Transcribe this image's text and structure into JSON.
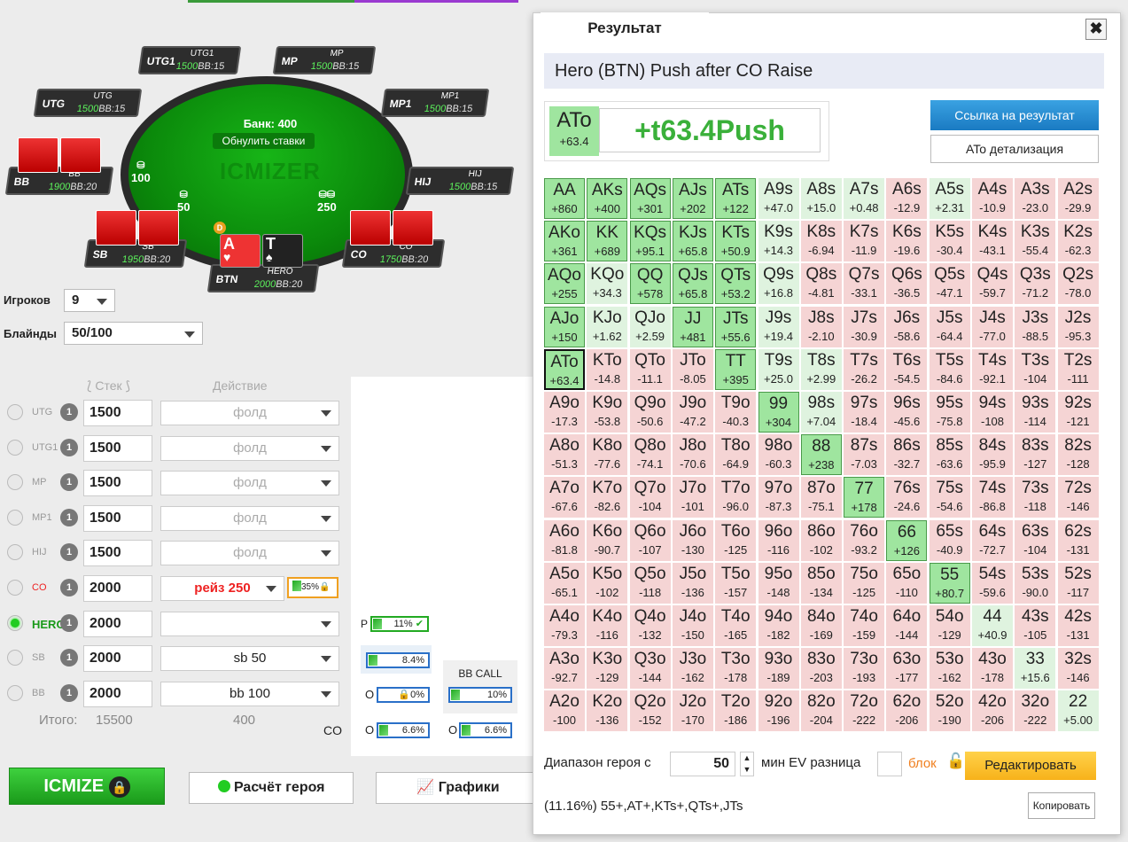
{
  "table": {
    "bank": "Банк: 400",
    "reset": "Обнулить ставки",
    "watermark": "ICMIZER",
    "seats": [
      {
        "id": "utg1",
        "n": "UTG1",
        "pn": "UTG1",
        "st": "1500",
        "bb": "BB:15"
      },
      {
        "id": "mp",
        "n": "MP",
        "pn": "MP",
        "st": "1500",
        "bb": "BB:15"
      },
      {
        "id": "utg",
        "n": "UTG",
        "pn": "UTG",
        "st": "1500",
        "bb": "BB:15"
      },
      {
        "id": "mp1",
        "n": "MP1",
        "pn": "MP1",
        "st": "1500",
        "bb": "BB:15"
      },
      {
        "id": "bb",
        "n": "BB",
        "pn": "BB",
        "st": "1900",
        "bb": "BB:20"
      },
      {
        "id": "hij",
        "n": "HIJ",
        "pn": "HIJ",
        "st": "1500",
        "bb": "BB:15"
      },
      {
        "id": "sb",
        "n": "SB",
        "pn": "SB",
        "st": "1950",
        "bb": "BB:20"
      },
      {
        "id": "co",
        "n": "CO",
        "pn": "CO",
        "st": "1750",
        "bb": "BB:20"
      },
      {
        "id": "btn",
        "n": "BTN",
        "pn": "HERO",
        "st": "2000",
        "bb": "BB:20"
      }
    ],
    "chips": {
      "bb": "100",
      "sb": "50",
      "co": "250"
    },
    "dealer": "D",
    "hero_cards": [
      "A",
      "T"
    ]
  },
  "players_label": "Игроков",
  "players_value": "9",
  "blinds_label": "Блайнды",
  "blinds_value": "50/100",
  "col_stack": "Стек",
  "col_action": "Действие",
  "positions": [
    {
      "pos": "UTG",
      "stack": "1500",
      "action": "фолд"
    },
    {
      "pos": "UTG1",
      "stack": "1500",
      "action": "фолд"
    },
    {
      "pos": "MP",
      "stack": "1500",
      "action": "фолд"
    },
    {
      "pos": "MP1",
      "stack": "1500",
      "action": "фолд"
    },
    {
      "pos": "HIJ",
      "stack": "1500",
      "action": "фолд"
    },
    {
      "pos": "CO",
      "stack": "2000",
      "action": "рейз 250"
    },
    {
      "pos": "HERO",
      "stack": "2000",
      "action": ""
    },
    {
      "pos": "SB",
      "stack": "2000",
      "action": "sb 50"
    },
    {
      "pos": "BB",
      "stack": "2000",
      "action": "bb 100"
    }
  ],
  "badge_one": "1",
  "co_range_pct": "35%",
  "total_label": "Итого:",
  "total_stack": "15500",
  "total_action": "400",
  "range_boxes": {
    "p_label": "P",
    "p_val": "11%",
    "v1": "8.4%",
    "bbcall_label": "BB CALL",
    "bbcall_val": "10%",
    "o1_label": "O",
    "o1_val": "0%",
    "o2_label": "O",
    "o2_val": "6.6%",
    "o3_label": "O",
    "o3_val": "6.6%",
    "co_label": "CO"
  },
  "buttons": {
    "icmize": "ICMIZE",
    "hero_calc": "Расчёт героя",
    "charts": "Графики"
  },
  "result": {
    "tab": "Результат",
    "close": "✖",
    "title": "Hero (BTN) Push after CO Raise",
    "hand": "ATo",
    "hand_ev": "+63.4",
    "verdict": "+t63.4Push",
    "link_btn": "Ссылка на результат",
    "detail_btn": "ATo детализация",
    "range_label": "Диапазон героя с",
    "range_value": "50",
    "ev_label": "мин EV разница",
    "block_label": "блок",
    "edit_btn": "Редактировать",
    "summary": "(11.16%) 55+,AT+,KTs+,QTs+,JTs",
    "copy_btn": "Копировать"
  },
  "colors": {
    "push": "#9fe59f",
    "fold": "#f5d4d4",
    "marginal": "#dff3df",
    "accent": "#3ab03a"
  },
  "grid": [
    [
      [
        "AA",
        "+860",
        "g"
      ],
      [
        "AKs",
        "+400",
        "g"
      ],
      [
        "AQs",
        "+301",
        "g"
      ],
      [
        "AJs",
        "+202",
        "g"
      ],
      [
        "ATs",
        "+122",
        "g"
      ],
      [
        "A9s",
        "+47.0",
        "lg"
      ],
      [
        "A8s",
        "+15.0",
        "lg"
      ],
      [
        "A7s",
        "+0.48",
        "lg"
      ],
      [
        "A6s",
        "-12.9",
        "r"
      ],
      [
        "A5s",
        "+2.31",
        "lg"
      ],
      [
        "A4s",
        "-10.9",
        "r"
      ],
      [
        "A3s",
        "-23.0",
        "r"
      ],
      [
        "A2s",
        "-29.9",
        "r"
      ]
    ],
    [
      [
        "AKo",
        "+361",
        "g"
      ],
      [
        "KK",
        "+689",
        "g"
      ],
      [
        "KQs",
        "+95.1",
        "g"
      ],
      [
        "KJs",
        "+65.8",
        "g"
      ],
      [
        "KTs",
        "+50.9",
        "g"
      ],
      [
        "K9s",
        "+14.3",
        "lg"
      ],
      [
        "K8s",
        "-6.94",
        "r"
      ],
      [
        "K7s",
        "-11.9",
        "r"
      ],
      [
        "K6s",
        "-19.6",
        "r"
      ],
      [
        "K5s",
        "-30.4",
        "r"
      ],
      [
        "K4s",
        "-43.1",
        "r"
      ],
      [
        "K3s",
        "-55.4",
        "r"
      ],
      [
        "K2s",
        "-62.3",
        "r"
      ]
    ],
    [
      [
        "AQo",
        "+255",
        "g"
      ],
      [
        "KQo",
        "+34.3",
        "lg"
      ],
      [
        "QQ",
        "+578",
        "g"
      ],
      [
        "QJs",
        "+65.8",
        "g"
      ],
      [
        "QTs",
        "+53.2",
        "g"
      ],
      [
        "Q9s",
        "+16.8",
        "lg"
      ],
      [
        "Q8s",
        "-4.81",
        "r"
      ],
      [
        "Q7s",
        "-33.1",
        "r"
      ],
      [
        "Q6s",
        "-36.5",
        "r"
      ],
      [
        "Q5s",
        "-47.1",
        "r"
      ],
      [
        "Q4s",
        "-59.7",
        "r"
      ],
      [
        "Q3s",
        "-71.2",
        "r"
      ],
      [
        "Q2s",
        "-78.0",
        "r"
      ]
    ],
    [
      [
        "AJo",
        "+150",
        "g"
      ],
      [
        "KJo",
        "+1.62",
        "lg"
      ],
      [
        "QJo",
        "+2.59",
        "lg"
      ],
      [
        "JJ",
        "+481",
        "g"
      ],
      [
        "JTs",
        "+55.6",
        "g"
      ],
      [
        "J9s",
        "+19.4",
        "lg"
      ],
      [
        "J8s",
        "-2.10",
        "r"
      ],
      [
        "J7s",
        "-30.9",
        "r"
      ],
      [
        "J6s",
        "-58.6",
        "r"
      ],
      [
        "J5s",
        "-64.4",
        "r"
      ],
      [
        "J4s",
        "-77.0",
        "r"
      ],
      [
        "J3s",
        "-88.5",
        "r"
      ],
      [
        "J2s",
        "-95.3",
        "r"
      ]
    ],
    [
      [
        "ATo",
        "+63.4",
        "gs"
      ],
      [
        "KTo",
        "-14.8",
        "r"
      ],
      [
        "QTo",
        "-11.1",
        "r"
      ],
      [
        "JTo",
        "-8.05",
        "r"
      ],
      [
        "TT",
        "+395",
        "g"
      ],
      [
        "T9s",
        "+25.0",
        "lg"
      ],
      [
        "T8s",
        "+2.99",
        "lg"
      ],
      [
        "T7s",
        "-26.2",
        "r"
      ],
      [
        "T6s",
        "-54.5",
        "r"
      ],
      [
        "T5s",
        "-84.6",
        "r"
      ],
      [
        "T4s",
        "-92.1",
        "r"
      ],
      [
        "T3s",
        "-104",
        "r"
      ],
      [
        "T2s",
        "-111",
        "r"
      ]
    ],
    [
      [
        "A9o",
        "-17.3",
        "r"
      ],
      [
        "K9o",
        "-53.8",
        "r"
      ],
      [
        "Q9o",
        "-50.6",
        "r"
      ],
      [
        "J9o",
        "-47.2",
        "r"
      ],
      [
        "T9o",
        "-40.3",
        "r"
      ],
      [
        "99",
        "+304",
        "g"
      ],
      [
        "98s",
        "+7.04",
        "lg"
      ],
      [
        "97s",
        "-18.4",
        "r"
      ],
      [
        "96s",
        "-45.6",
        "r"
      ],
      [
        "95s",
        "-75.8",
        "r"
      ],
      [
        "94s",
        "-108",
        "r"
      ],
      [
        "93s",
        "-114",
        "r"
      ],
      [
        "92s",
        "-121",
        "r"
      ]
    ],
    [
      [
        "A8o",
        "-51.3",
        "r"
      ],
      [
        "K8o",
        "-77.6",
        "r"
      ],
      [
        "Q8o",
        "-74.1",
        "r"
      ],
      [
        "J8o",
        "-70.6",
        "r"
      ],
      [
        "T8o",
        "-64.9",
        "r"
      ],
      [
        "98o",
        "-60.3",
        "r"
      ],
      [
        "88",
        "+238",
        "g"
      ],
      [
        "87s",
        "-7.03",
        "r"
      ],
      [
        "86s",
        "-32.7",
        "r"
      ],
      [
        "85s",
        "-63.6",
        "r"
      ],
      [
        "84s",
        "-95.9",
        "r"
      ],
      [
        "83s",
        "-127",
        "r"
      ],
      [
        "82s",
        "-128",
        "r"
      ]
    ],
    [
      [
        "A7o",
        "-67.6",
        "r"
      ],
      [
        "K7o",
        "-82.6",
        "r"
      ],
      [
        "Q7o",
        "-104",
        "r"
      ],
      [
        "J7o",
        "-101",
        "r"
      ],
      [
        "T7o",
        "-96.0",
        "r"
      ],
      [
        "97o",
        "-87.3",
        "r"
      ],
      [
        "87o",
        "-75.1",
        "r"
      ],
      [
        "77",
        "+178",
        "g"
      ],
      [
        "76s",
        "-24.6",
        "r"
      ],
      [
        "75s",
        "-54.6",
        "r"
      ],
      [
        "74s",
        "-86.8",
        "r"
      ],
      [
        "73s",
        "-118",
        "r"
      ],
      [
        "72s",
        "-146",
        "r"
      ]
    ],
    [
      [
        "A6o",
        "-81.8",
        "r"
      ],
      [
        "K6o",
        "-90.7",
        "r"
      ],
      [
        "Q6o",
        "-107",
        "r"
      ],
      [
        "J6o",
        "-130",
        "r"
      ],
      [
        "T6o",
        "-125",
        "r"
      ],
      [
        "96o",
        "-116",
        "r"
      ],
      [
        "86o",
        "-102",
        "r"
      ],
      [
        "76o",
        "-93.2",
        "r"
      ],
      [
        "66",
        "+126",
        "g"
      ],
      [
        "65s",
        "-40.9",
        "r"
      ],
      [
        "64s",
        "-72.7",
        "r"
      ],
      [
        "63s",
        "-104",
        "r"
      ],
      [
        "62s",
        "-131",
        "r"
      ]
    ],
    [
      [
        "A5o",
        "-65.1",
        "r"
      ],
      [
        "K5o",
        "-102",
        "r"
      ],
      [
        "Q5o",
        "-118",
        "r"
      ],
      [
        "J5o",
        "-136",
        "r"
      ],
      [
        "T5o",
        "-157",
        "r"
      ],
      [
        "95o",
        "-148",
        "r"
      ],
      [
        "85o",
        "-134",
        "r"
      ],
      [
        "75o",
        "-125",
        "r"
      ],
      [
        "65o",
        "-110",
        "r"
      ],
      [
        "55",
        "+80.7",
        "g"
      ],
      [
        "54s",
        "-59.6",
        "r"
      ],
      [
        "53s",
        "-90.0",
        "r"
      ],
      [
        "52s",
        "-117",
        "r"
      ]
    ],
    [
      [
        "A4o",
        "-79.3",
        "r"
      ],
      [
        "K4o",
        "-116",
        "r"
      ],
      [
        "Q4o",
        "-132",
        "r"
      ],
      [
        "J4o",
        "-150",
        "r"
      ],
      [
        "T4o",
        "-165",
        "r"
      ],
      [
        "94o",
        "-182",
        "r"
      ],
      [
        "84o",
        "-169",
        "r"
      ],
      [
        "74o",
        "-159",
        "r"
      ],
      [
        "64o",
        "-144",
        "r"
      ],
      [
        "54o",
        "-129",
        "r"
      ],
      [
        "44",
        "+40.9",
        "lg"
      ],
      [
        "43s",
        "-105",
        "r"
      ],
      [
        "42s",
        "-131",
        "r"
      ]
    ],
    [
      [
        "A3o",
        "-92.7",
        "r"
      ],
      [
        "K3o",
        "-129",
        "r"
      ],
      [
        "Q3o",
        "-144",
        "r"
      ],
      [
        "J3o",
        "-162",
        "r"
      ],
      [
        "T3o",
        "-178",
        "r"
      ],
      [
        "93o",
        "-189",
        "r"
      ],
      [
        "83o",
        "-203",
        "r"
      ],
      [
        "73o",
        "-193",
        "r"
      ],
      [
        "63o",
        "-177",
        "r"
      ],
      [
        "53o",
        "-162",
        "r"
      ],
      [
        "43o",
        "-178",
        "r"
      ],
      [
        "33",
        "+15.6",
        "lg"
      ],
      [
        "32s",
        "-146",
        "r"
      ]
    ],
    [
      [
        "A2o",
        "-100",
        "r"
      ],
      [
        "K2o",
        "-136",
        "r"
      ],
      [
        "Q2o",
        "-152",
        "r"
      ],
      [
        "J2o",
        "-170",
        "r"
      ],
      [
        "T2o",
        "-186",
        "r"
      ],
      [
        "92o",
        "-196",
        "r"
      ],
      [
        "82o",
        "-204",
        "r"
      ],
      [
        "72o",
        "-222",
        "r"
      ],
      [
        "62o",
        "-206",
        "r"
      ],
      [
        "52o",
        "-190",
        "r"
      ],
      [
        "42o",
        "-206",
        "r"
      ],
      [
        "32o",
        "-222",
        "r"
      ],
      [
        "22",
        "+5.00",
        "lg"
      ]
    ]
  ]
}
